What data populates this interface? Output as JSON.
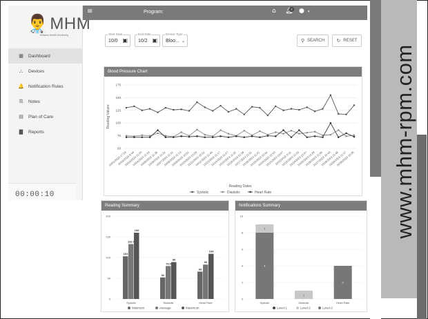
{
  "app": {
    "logo_mark": "👨‍⚕",
    "logo_text": "MHM",
    "logo_subtext": "Midwest Health Monitoring",
    "program_label": "Program:",
    "notification_count": "2",
    "timer": "00:00:10"
  },
  "sidebar": {
    "items": [
      {
        "label": "Dashboard",
        "icon": "grid-icon",
        "glyph": "▦",
        "active": true
      },
      {
        "label": "Devices",
        "icon": "devices-icon",
        "glyph": "⛬",
        "active": false
      },
      {
        "label": "Notification Rules",
        "icon": "bell-icon",
        "glyph": "🔔",
        "active": false
      },
      {
        "label": "Notes",
        "icon": "notes-icon",
        "glyph": "☰",
        "active": false
      },
      {
        "label": "Plan of Care",
        "icon": "plan-icon",
        "glyph": "▤",
        "active": false
      },
      {
        "label": "Reports",
        "icon": "reports-icon",
        "glyph": "▇",
        "active": false
      }
    ]
  },
  "filters": {
    "start_date": {
      "label": "Start Date",
      "value": "10/0"
    },
    "end_date": {
      "label": "End Date",
      "value": "10/2"
    },
    "device_type": {
      "label": "Device Type",
      "value": "Bloo..."
    },
    "search_label": "SEARCH",
    "reset_label": "RESET"
  },
  "colors": {
    "header_bar": "#7a7a7a",
    "card_header": "#7d7d7d",
    "systolic": "#555555",
    "diastolic": "#8a8a8a",
    "heart_rate": "#3a3a3a"
  },
  "bp_card": {
    "title": "Blood Pressure Chart",
    "legend": [
      "Systolic",
      "Diastolic",
      "Heart Rate"
    ]
  },
  "reading_card": {
    "title": "Reading Summary",
    "legend": [
      "Minimum",
      "Average",
      "Maximum"
    ]
  },
  "alert_card": {
    "title": "Notifications Summary",
    "legend": [
      "Level-1",
      "Level-2",
      "Level-3"
    ]
  },
  "watermark": "www.mhm-rpm.com",
  "chart_data": [
    {
      "type": "line",
      "title": "Blood Pressure Chart",
      "xlabel": "Reading Dates",
      "ylabel": "Reading Values",
      "ylim": [
        50,
        175
      ],
      "yticks": [
        50,
        75,
        100,
        125,
        150,
        175
      ],
      "categories": [
        "10/01/2023 17:53",
        "10/02/2023 8:44",
        "10/03/2023 11:23",
        "10/04/2023 11:33",
        "10/05/2023 11:35",
        "10/06/2023 11:31",
        "10/07/2023 11:31",
        "10/08/2023 11:13",
        "10/09/2023 10:51",
        "10/10/2023 10:25",
        "10/11/2023 10:22",
        "10/12/2023 11:46",
        "10/13/2023 11:17",
        "10/14/2023 11:27",
        "10/15/2023 11:32",
        "10/16/2023 11:36",
        "10/17/2023 11:31",
        "10/18/2023 11:41",
        "10/19/2023 10:44",
        "10/20/2023 10:10",
        "10/21/2023 10:07",
        "10/22/2023 9:11",
        "10/23/2023 11:20",
        "10/24/2023 12:07",
        "10/25/2023 11:39",
        "10/26/2023 11:09",
        "10/27/2023 10:43",
        "10/28/2023 11:48",
        "10/29/2023 11:17",
        "10/30/2023 10:55"
      ],
      "series": [
        {
          "name": "Systolic",
          "values": [
            130,
            133,
            125,
            128,
            121,
            130,
            126,
            127,
            124,
            141,
            131,
            124,
            134,
            122,
            128,
            117,
            132,
            130,
            115,
            133,
            125,
            128,
            126,
            131,
            123,
            128,
            155,
            118,
            117,
            135
          ]
        },
        {
          "name": "Diastolic",
          "values": [
            75,
            74,
            76,
            75,
            80,
            75,
            73,
            82,
            75,
            87,
            77,
            74,
            86,
            79,
            75,
            85,
            76,
            84,
            77,
            82,
            79,
            85,
            79,
            81,
            83,
            76,
            77,
            86,
            74,
            76
          ]
        },
        {
          "name": "Heart Rate",
          "values": [
            72,
            72,
            72,
            72,
            86,
            72,
            72,
            74,
            73,
            74,
            72,
            72,
            74,
            72,
            74,
            72,
            74,
            72,
            75,
            74,
            86,
            72,
            86,
            72,
            74,
            72,
            100,
            72,
            80,
            73
          ]
        }
      ]
    },
    {
      "type": "bar",
      "title": "Reading Summary",
      "categories": [
        "Systolic",
        "Diastolic",
        "Heart Rate"
      ],
      "ylim": [
        0,
        200
      ],
      "yticks": [
        0,
        50,
        100,
        150,
        200
      ],
      "series": [
        {
          "name": "Minimum",
          "values": [
            103,
            52,
            66
          ]
        },
        {
          "name": "Average",
          "values": [
            132.5,
            79.5,
            83
          ]
        },
        {
          "name": "Maximum",
          "values": [
            160,
            89,
            109
          ]
        }
      ]
    },
    {
      "type": "bar",
      "stacked": true,
      "title": "Notifications Summary",
      "categories": [
        "Systolic",
        "Diastolic",
        "Heart Rate"
      ],
      "ylim": [
        0,
        10
      ],
      "yticks": [
        0,
        2,
        4,
        6,
        8,
        10
      ],
      "series": [
        {
          "name": "Level-1",
          "values": [
            0,
            0,
            0
          ]
        },
        {
          "name": "Level-2",
          "values": [
            1,
            1,
            0
          ]
        },
        {
          "name": "Level-3",
          "values": [
            8,
            0,
            4
          ]
        }
      ],
      "data_labels": {
        "Level-2": [
          "1",
          "1",
          ""
        ],
        "Level-3": [
          "4",
          "",
          "2"
        ]
      }
    }
  ]
}
